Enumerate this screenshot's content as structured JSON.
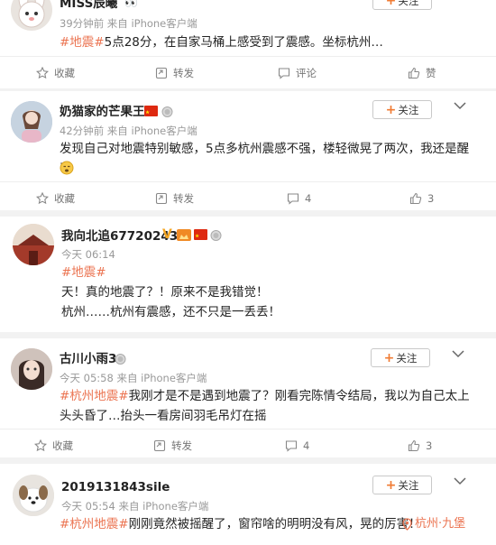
{
  "posts": [
    {
      "username": "MISS辰曦",
      "meta": "39分钟前 来自 iPhone客户端",
      "follow": "关注",
      "hashtag": "#地震#",
      "text": "5点28分，在自家马桶上感受到了震感。坐标杭州…",
      "actions": {
        "repost": "收藏",
        "share": "转发",
        "comment": "评论",
        "like": "赞"
      }
    },
    {
      "username": "奶猫家的芒果王",
      "meta": "42分钟前 来自 iPhone客户端",
      "follow": "关注",
      "text": "发现自己对地震特别敏感，5点多杭州震感不强，楼轻微晃了两次，我还是醒了",
      "actions": {
        "repost": "收藏",
        "share": "转发",
        "comment": "4",
        "like": "3"
      }
    },
    {
      "username": "我向北追67720243",
      "meta": "今天 06:14",
      "hashtag": "#地震#",
      "line1": "天！真的地震了？！原来不是我错觉！",
      "line2": "杭州……杭州有震感，还不只是一丢丢！"
    },
    {
      "username": "古川小雨3",
      "meta": "今天 05:58 来自 iPhone客户端",
      "follow": "关注",
      "hashtag": "#杭州地震#",
      "text": "我刚才是不是遇到地震了？刚看完陈情令结局，我以为自己太上头头昏了…抬头一看房间羽毛吊灯在摇",
      "actions": {
        "repost": "收藏",
        "share": "转发",
        "comment": "4",
        "like": "3"
      }
    },
    {
      "username": "2019131843sile",
      "meta": "今天 05:54 来自 iPhone客户端",
      "follow": "关注",
      "hashtag": "#杭州地震#",
      "text": "刚刚竟然被摇醒了，窗帘啥的明明没有风，晃的厉害！",
      "location": "杭州·九堡"
    }
  ],
  "colors": {
    "accent": "#eb7350",
    "follow_plus": "#f07b33",
    "vip": "#f5a623",
    "bg": "#f2f2f2"
  }
}
